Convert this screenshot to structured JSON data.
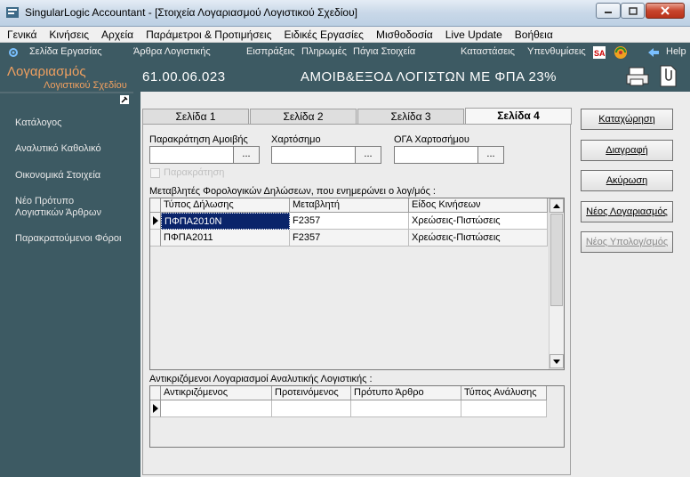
{
  "window": {
    "title": "SingularLogic Accountant - [Στοιχεία Λογαριασμού Λογιστικού Σχεδίου]"
  },
  "menu": [
    "Γενικά",
    "Κινήσεις",
    "Αρχεία",
    "Παράμετροι & Προτιμήσεις",
    "Ειδικές Εργασίες",
    "Μισθοδοσία",
    "Live Update",
    "Βοήθεια"
  ],
  "toolbar": {
    "work_page": "Σελίδα Εργασίας",
    "accounting_entries": "Άρθρα Λογιστικής",
    "receipts": "Εισπράξεις",
    "payments": "Πληρωμές",
    "fixed_assets": "Πάγια Στοιχεία",
    "statements": "Καταστάσεις",
    "reminders": "Υπενθυμίσεις",
    "help": "Help"
  },
  "left": {
    "heading1": "Λογαριασμός",
    "heading2": "Λογιστικού Σχεδίου",
    "items": [
      "Κατάλογος",
      "Αναλυτικό Καθολικό",
      "Οικονομικά Στοιχεία",
      "Νέο Πρότυπο",
      "Λογιστικών Άρθρων",
      "Παρακρατούμενοι Φόροι"
    ]
  },
  "header": {
    "account_code": "61.00.06.023",
    "account_name": "ΑΜΟΙΒ&ΕΞΟΔ ΛΟΓΙΣΤΩΝ ΜΕ ΦΠΑ 23%"
  },
  "tabs": [
    "Σελίδα 1",
    "Σελίδα 2",
    "Σελίδα 3",
    "Σελίδα 4"
  ],
  "active_tab": 3,
  "form": {
    "fee_withholding_label": "Παρακράτηση Αμοιβής",
    "stamp_label": "Χαρτόσημο",
    "oga_label": "ΟΓΑ Χαρτοσήμου",
    "browse": "...",
    "withholding_checkbox": "Παρακράτηση",
    "tax_vars_label": "Μεταβλητές Φορολογικών Δηλώσεων, που ενημερώνει ο λογ/μός :",
    "tax_grid": {
      "columns": [
        "Τύπος Δήλωσης",
        "Μεταβλητή",
        "Είδος Κινήσεων"
      ],
      "rows": [
        [
          "ΠΦΠΑ2010Ν",
          "F2357",
          "Χρεώσεις-Πιστώσεις"
        ],
        [
          "ΠΦΠΑ2011",
          "F2357",
          "Χρεώσεις-Πιστώσεις"
        ]
      ]
    },
    "analytic_label": "Αντικριζόμενοι Λογαριασμοί Αναλυτικής Λογιστικής :",
    "analytic_grid": {
      "columns": [
        "Αντικριζόμενος",
        "Προτεινόμενος",
        "Πρότυπο Άρθρο",
        "Τύπος Ανάλυσης"
      ]
    }
  },
  "actions": {
    "save": "Καταχώρηση",
    "delete": "Διαγραφή",
    "cancel": "Ακύρωση",
    "new_account": "Νέος Λογαριασμός",
    "new_subaccount": "Νέος Υπολογ/σμός"
  }
}
